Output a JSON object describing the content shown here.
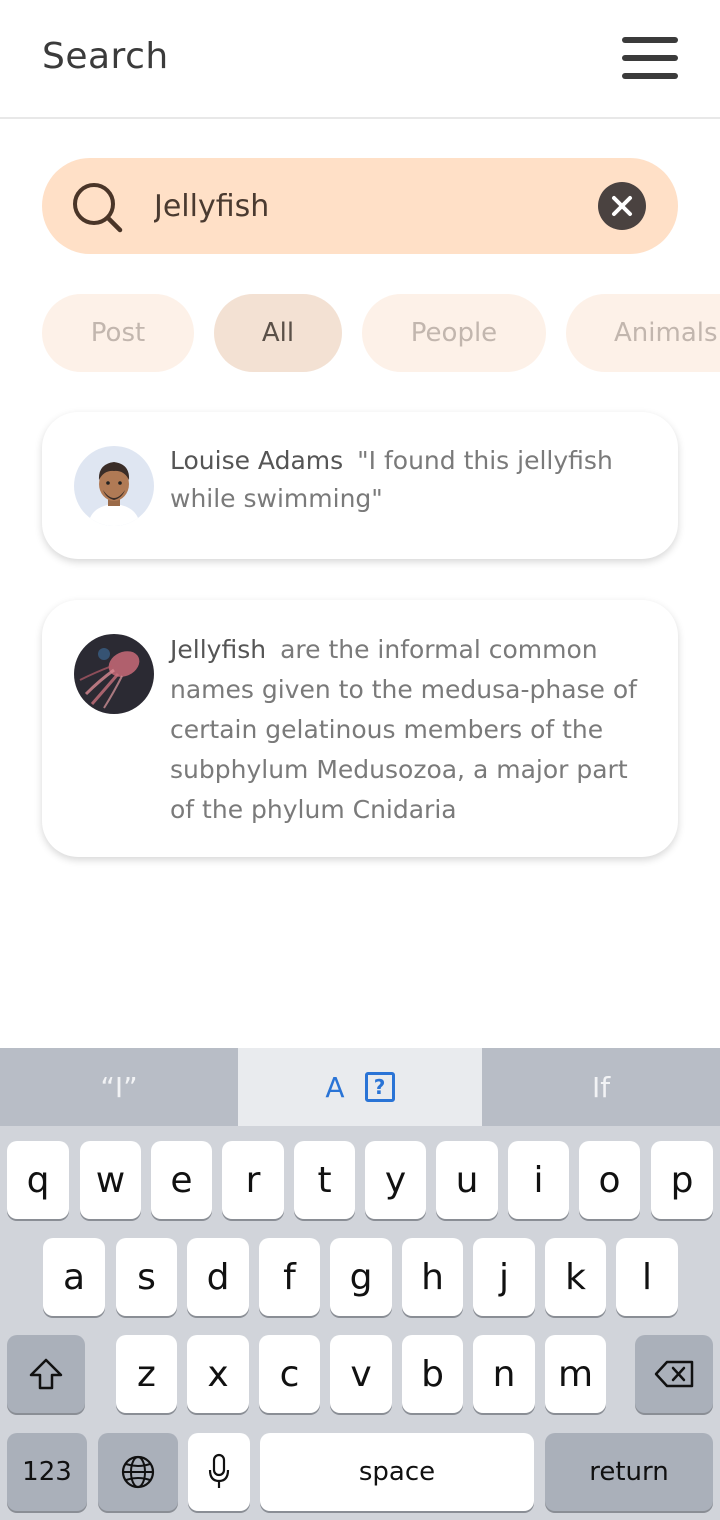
{
  "header": {
    "title": "Search"
  },
  "search": {
    "value": "Jellyfish",
    "placeholder": "Search"
  },
  "filters": [
    {
      "label": "Post",
      "active": false
    },
    {
      "label": "All",
      "active": true
    },
    {
      "label": "People",
      "active": false
    },
    {
      "label": "Animals",
      "active": false
    }
  ],
  "results": [
    {
      "name": "Louise Adams",
      "text": "\"I found this jellyfish while swimming\""
    },
    {
      "name": "Jellyfish",
      "text": "are the informal common names given to the medusa-phase of certain gelatinous members of the subphylum Medusozoa, a major part of the phylum Cnidaria"
    }
  ],
  "keyboard": {
    "suggestions": [
      "“I”",
      "A",
      "If"
    ],
    "row1": [
      "q",
      "w",
      "e",
      "r",
      "t",
      "y",
      "u",
      "i",
      "o",
      "p"
    ],
    "row2": [
      "a",
      "s",
      "d",
      "f",
      "g",
      "h",
      "j",
      "k",
      "l"
    ],
    "row3": [
      "z",
      "x",
      "c",
      "v",
      "b",
      "n",
      "m"
    ],
    "numbers_label": "123",
    "space_label": "space",
    "return_label": "return"
  },
  "colors": {
    "search_bg": "#ffe0c7",
    "chip_active": "#f3e1d3",
    "chip_inactive": "#fdf1e8",
    "accent_blue": "#2a74d6"
  }
}
